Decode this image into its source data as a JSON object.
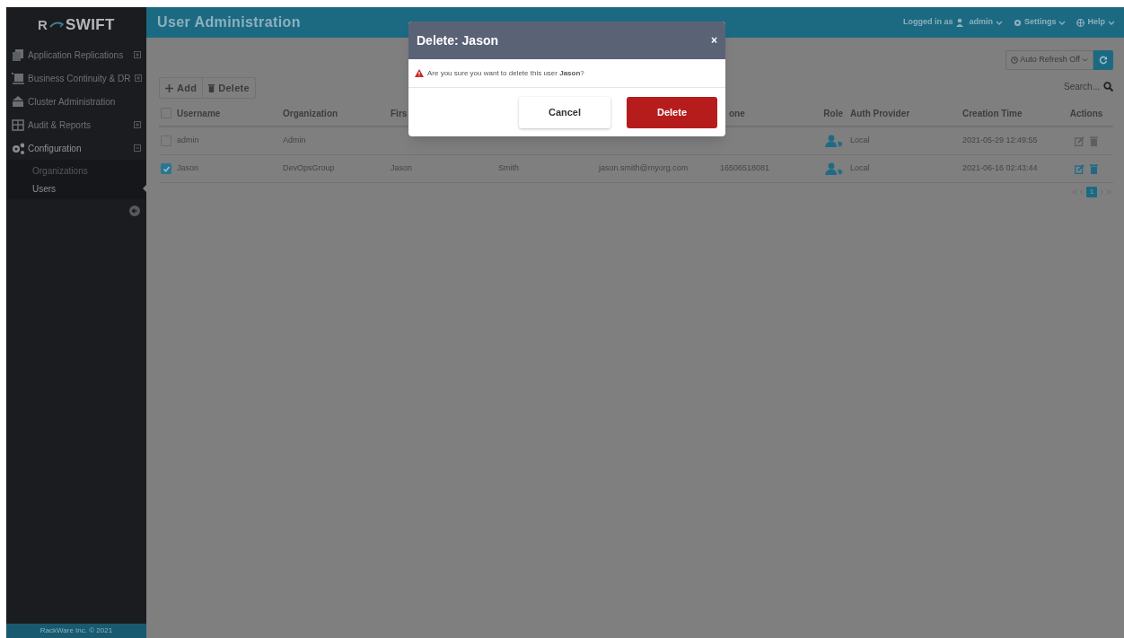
{
  "sidebar": {
    "logo": {
      "left": "R",
      "right": "SWIFT"
    },
    "items": [
      {
        "label": "Application Replications",
        "expanded": false
      },
      {
        "label": "Business Continuity & DR",
        "expanded": false
      },
      {
        "label": "Cluster Administration"
      },
      {
        "label": "Audit & Reports",
        "expanded": false
      },
      {
        "label": "Configuration",
        "expanded": true,
        "children": [
          {
            "label": "Organizations",
            "selected": false
          },
          {
            "label": "Users",
            "selected": true
          }
        ]
      }
    ],
    "footer": "RackWare Inc. © 2021"
  },
  "header": {
    "title": "User Administration",
    "logged_in_label": "Logged in as",
    "user": "admin",
    "settings": "Settings",
    "help": "Help"
  },
  "toolbar": {
    "add": "Add",
    "delete": "Delete",
    "auto_refresh": "Auto Refresh Off",
    "search_placeholder": "Search..."
  },
  "table": {
    "columns": [
      {
        "kind": "text",
        "label": "Username"
      },
      {
        "kind": "text",
        "label": "Organization"
      },
      {
        "kind": "text",
        "label": "Firs"
      },
      {
        "kind": "text"
      },
      {
        "kind": "text"
      },
      {
        "kind": "text",
        "label": "one"
      },
      {
        "kind": "role",
        "label": "Role"
      },
      {
        "kind": "text",
        "label": "Auth Provider"
      },
      {
        "kind": "text",
        "label": "Creation Time"
      },
      {
        "kind": "actions",
        "label": "Actions"
      }
    ],
    "all_checked": false,
    "rows": [
      {
        "checked": false,
        "actions_disabled": true,
        "cells": [
          "admin",
          "Admin",
          null,
          null,
          null,
          null,
          null,
          "Local",
          "2021-05-29 12:49:55",
          null
        ]
      },
      {
        "checked": true,
        "actions_disabled": false,
        "cells": [
          "Jason",
          "DevOpsGroup",
          "Jason",
          "Smith",
          "jason.smith@myorg.com",
          "16506518081",
          null,
          "Local",
          "2021-06-16 02:43:44",
          null
        ]
      }
    ],
    "pages": [
      {
        "label": "1",
        "selected": true
      }
    ]
  },
  "dialog": {
    "title": "Delete: Jason",
    "close": "×",
    "message": "Are you sure you want to delete this user **Jason**?",
    "cancel": "Cancel",
    "confirm": "Delete"
  }
}
